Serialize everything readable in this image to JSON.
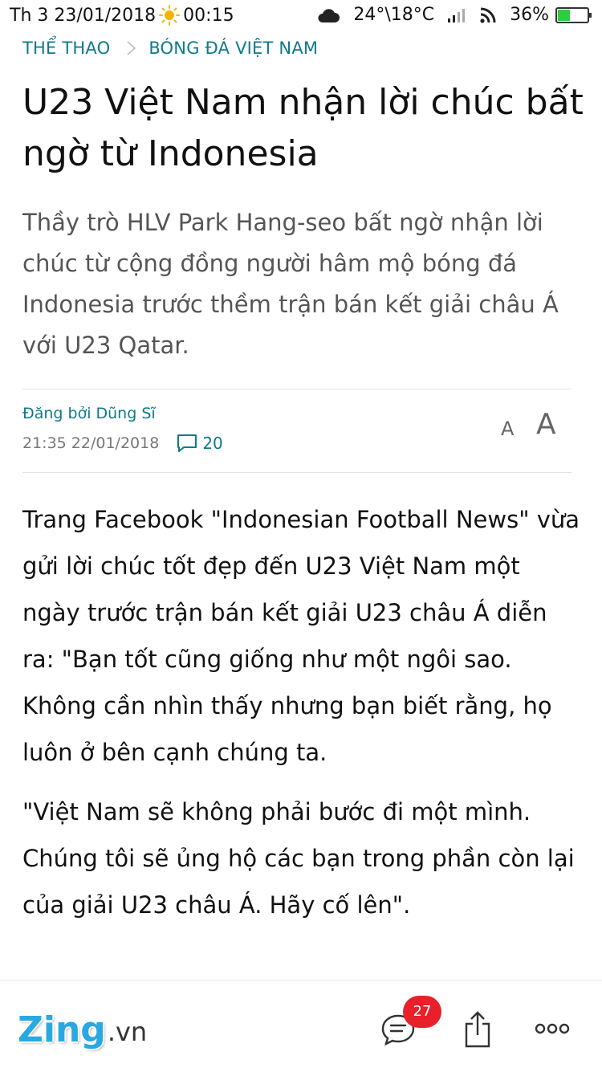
{
  "status_bar": {
    "datetime": "Th 3 23/01/2018",
    "time": "00:15",
    "weather": "24°\\18°C",
    "battery": "36%",
    "icons": [
      "sun-icon",
      "cloud-icon",
      "signal-icon",
      "wifi-icon",
      "battery-icon"
    ]
  },
  "breadcrumb": {
    "section": "THỂ THAO",
    "subsection": "BÓNG ĐÁ VIỆT NAM"
  },
  "article": {
    "title": "U23 Việt Nam nhận lời chúc bất ngờ từ Indonesia",
    "lead": "Thầy trò HLV Park Hang-seo bất ngờ nhận lời chúc từ cộng đồng người hâm mộ bóng đá Indonesia trước thềm trận bán kết giải châu Á với U23 Qatar.",
    "author": "Đăng bởi Dũng Sĩ",
    "timestamp": "21:35 22/01/2018",
    "comment_count": "20",
    "font_small_label": "A",
    "font_large_label": "A",
    "paragraphs": [
      "Trang Facebook \"Indonesian Football News\" vừa gửi lời chúc tốt đẹp đến U23 Việt Nam một ngày trước trận bán kết giải U23 châu Á diễn ra: \"Bạn tốt cũng giống như một ngôi sao. Không cần nhìn thấy nhưng bạn biết rằng, họ luôn ở bên cạnh chúng ta.",
      "\"Việt Nam sẽ không phải bước đi một mình. Chúng tôi sẽ ủng hộ các bạn trong phần còn lại của giải U23 châu Á. Hãy cố lên\"."
    ]
  },
  "bottom_bar": {
    "logo_main": "Zing",
    "logo_suffix": ".vn",
    "comments_badge": "27",
    "icons": [
      "comments-icon",
      "share-icon",
      "more-icon"
    ]
  },
  "colors": {
    "accent": "#0d7a8a",
    "badge": "#e8202a",
    "logo": "#2aa9e0",
    "lead_text": "#555555"
  }
}
